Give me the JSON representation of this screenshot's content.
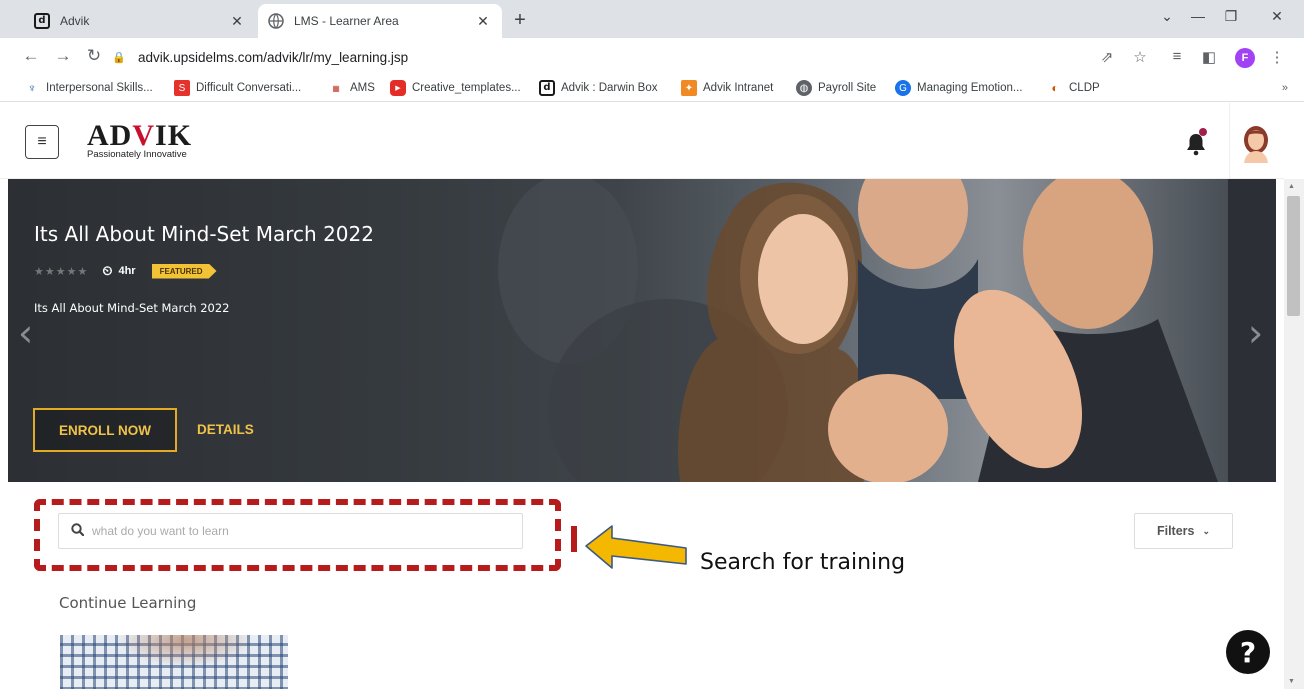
{
  "browser": {
    "tabs": [
      {
        "title": "Advik",
        "active": false
      },
      {
        "title": "LMS - Learner Area",
        "active": true
      }
    ],
    "url": "advik.upsidelms.com/advik/lr/my_learning.jsp",
    "profile_initial": "F",
    "bookmarks": [
      {
        "label": "Interpersonal Skills...",
        "icon": "interpersonal-icon"
      },
      {
        "label": "Difficult Conversati...",
        "icon": "difficult-conversations-icon"
      },
      {
        "label": "AMS",
        "icon": "ams-icon"
      },
      {
        "label": "Creative_templates...",
        "icon": "youtube-icon"
      },
      {
        "label": "Advik : Darwin Box",
        "icon": "darwin-box-icon"
      },
      {
        "label": "Advik Intranet",
        "icon": "intranet-icon"
      },
      {
        "label": "Payroll Site",
        "icon": "globe-icon"
      },
      {
        "label": "Managing Emotion...",
        "icon": "managing-emotion-icon"
      },
      {
        "label": "CLDP",
        "icon": "cldp-icon"
      }
    ],
    "bookmarks_overflow": "»"
  },
  "header": {
    "brand_name_part1": "AD",
    "brand_name_v": "V",
    "brand_name_part2": "IK",
    "brand_tagline": "Passionately Innovative"
  },
  "hero": {
    "title": "Its All About Mind-Set March 2022",
    "rating_stars": "★★★★★",
    "duration": "4hr",
    "badge": "FEATURED",
    "subtitle": "Its All About Mind-Set March 2022",
    "enroll_label": "ENROLL NOW",
    "details_label": "DETAILS"
  },
  "search": {
    "placeholder": "what do you want to learn",
    "filters_label": "Filters"
  },
  "annotation": {
    "callout": "Search for training"
  },
  "sections": {
    "continue_learning": "Continue Learning"
  },
  "help": {
    "label": "?"
  },
  "colors": {
    "accent_gold": "#f0c248",
    "highlight_red": "#b71c1c",
    "callout_arrow": "#f5b800"
  }
}
